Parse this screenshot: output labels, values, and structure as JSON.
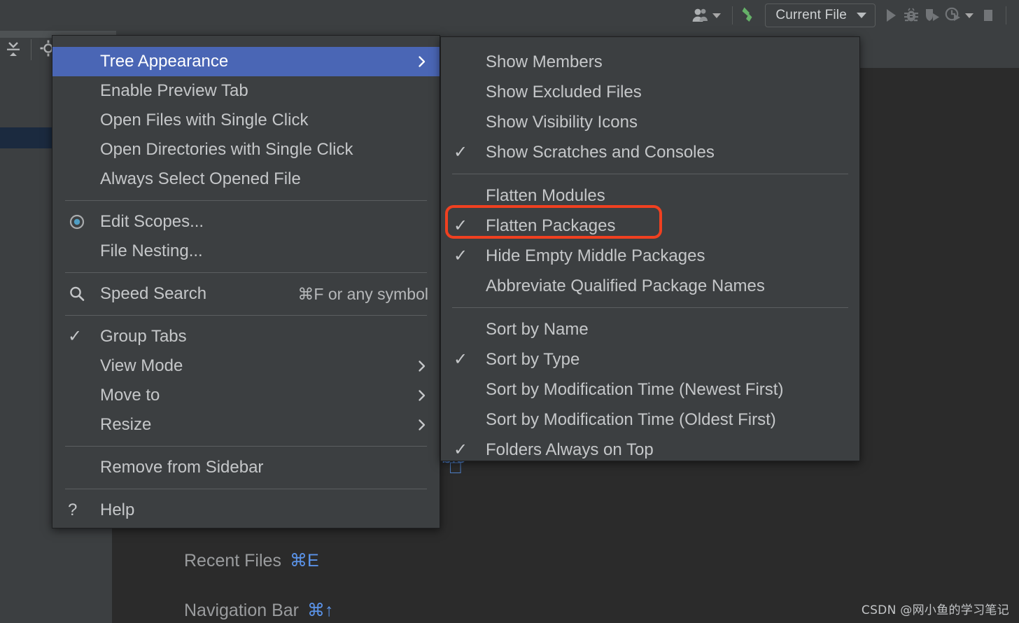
{
  "toolbar": {
    "people_icon": "people-icon",
    "build_icon": "hammer-build-icon",
    "run_config_label": "Current File",
    "run_icon": "run-play-icon",
    "debug_icon": "debug-bug-icon",
    "coverage_icon": "run-with-coverage-icon",
    "profiler_icon": "run-with-profiler-icon",
    "more_caret_icon": "chevron-down-icon",
    "stop_icon": "stop-square-icon"
  },
  "tool_window": {
    "collapse_icon": "collapse-all-icon",
    "gear_icon": "gear-icon"
  },
  "menu": {
    "items": [
      {
        "label": "Tree Appearance",
        "selected": true,
        "arrow": true,
        "gutter": ""
      },
      {
        "label": "Enable Preview Tab",
        "gutter": ""
      },
      {
        "label": "Open Files with Single Click",
        "gutter": ""
      },
      {
        "label": "Open Directories with Single Click",
        "gutter": ""
      },
      {
        "label": "Always Select Opened File",
        "gutter": ""
      },
      {
        "separator": true
      },
      {
        "label": "Edit Scopes...",
        "gutter": "radio"
      },
      {
        "label": "File Nesting...",
        "gutter": ""
      },
      {
        "separator": true
      },
      {
        "label": "Speed Search",
        "gutter": "search",
        "accel": "⌘F or any symbol"
      },
      {
        "separator": true
      },
      {
        "label": "Group Tabs",
        "gutter": "check"
      },
      {
        "label": "View Mode",
        "gutter": "",
        "arrow": true
      },
      {
        "label": "Move to",
        "gutter": "",
        "arrow": true
      },
      {
        "label": "Resize",
        "gutter": "",
        "arrow": true
      },
      {
        "separator": true
      },
      {
        "label": "Remove from Sidebar",
        "gutter": ""
      },
      {
        "separator": true
      },
      {
        "label": "Help",
        "gutter": "question"
      }
    ]
  },
  "submenu": {
    "items": [
      {
        "label": "Show Members",
        "gutter": ""
      },
      {
        "label": "Show Excluded Files",
        "gutter": ""
      },
      {
        "label": "Show Visibility Icons",
        "gutter": ""
      },
      {
        "label": "Show Scratches and Consoles",
        "gutter": "check"
      },
      {
        "separator": true
      },
      {
        "label": "Flatten Modules",
        "gutter": ""
      },
      {
        "label": "Flatten Packages",
        "gutter": "check",
        "highlighted": true
      },
      {
        "label": "Hide Empty Middle Packages",
        "gutter": "check"
      },
      {
        "label": "Abbreviate Qualified Package Names",
        "gutter": ""
      },
      {
        "separator": true
      },
      {
        "label": "Sort by Name",
        "gutter": ""
      },
      {
        "label": "Sort by Type",
        "gutter": "check"
      },
      {
        "label": "Sort by Modification Time (Newest First)",
        "gutter": ""
      },
      {
        "label": "Sort by Modification Time (Oldest First)",
        "gutter": ""
      },
      {
        "label": "Folders Always on Top",
        "gutter": "check"
      }
    ]
  },
  "hints": {
    "recent_files_label": "Recent Files",
    "recent_files_key": "⌘E",
    "navigation_bar_label": "Navigation Bar",
    "navigation_bar_key": "⌘↑"
  },
  "background": {
    "ghost_text_1": "ble",
    "ghost_text_2": "□"
  },
  "watermark": {
    "text": "CSDN @网小鱼的学习笔记"
  },
  "colors": {
    "accent_selection": "#4a66b5",
    "annotation": "#f04020",
    "menu_bg": "#3c3f41",
    "editor_bg": "#2b2b2b",
    "tree_selection": "#1b2a3f",
    "shortcut_blue": "#5b93e8",
    "build_green": "#65b168"
  }
}
